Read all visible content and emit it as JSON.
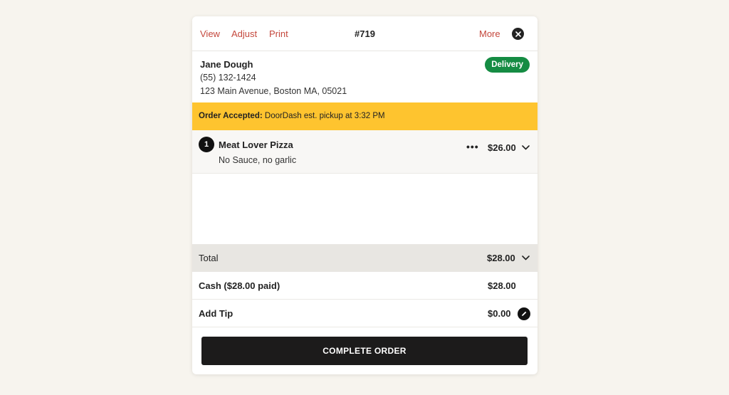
{
  "header": {
    "view_label": "View",
    "adjust_label": "Adjust",
    "print_label": "Print",
    "order_number": "#719",
    "more_label": "More"
  },
  "customer": {
    "name": "Jane Dough",
    "phone": "(55) 132-1424",
    "address": "123 Main Avenue, Boston MA, 05021",
    "badge": "Delivery"
  },
  "banner": {
    "status": "Order Accepted:",
    "detail": " DoorDash est. pickup at 3:32 PM"
  },
  "items": [
    {
      "qty": "1",
      "name": "Meat Lover Pizza",
      "modifier": "No Sauce, no garlic",
      "more": "•••",
      "price": "$26.00"
    }
  ],
  "totals": {
    "total_label": "Total",
    "total_value": "$28.00",
    "payment_label": "Cash ($28.00 paid)",
    "payment_value": "$28.00",
    "tip_label": "Add Tip",
    "tip_value": "$0.00"
  },
  "actions": {
    "complete_label": "COMPLETE ORDER"
  },
  "colors": {
    "accent": "#c4473c",
    "banner": "#fec42f",
    "badge": "#158c43",
    "button": "#1c1b1b",
    "background": "#f7f4ee"
  },
  "icons": {
    "close": "close-icon",
    "chevron": "chevron-down-icon",
    "edit": "pencil-icon"
  }
}
